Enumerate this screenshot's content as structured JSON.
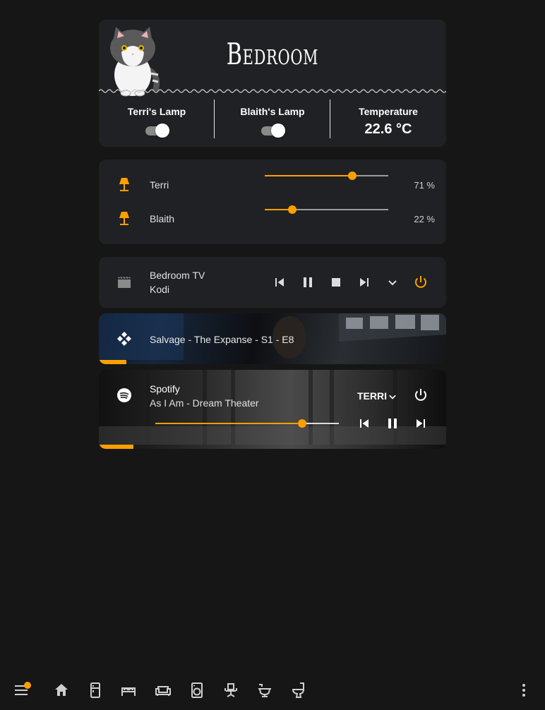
{
  "header": {
    "title": "Bedroom",
    "columns": [
      {
        "label": "Terri's Lamp",
        "type": "toggle",
        "on": true
      },
      {
        "label": "Blaith's Lamp",
        "type": "toggle",
        "on": true
      },
      {
        "label": "Temperature",
        "type": "value",
        "value": "22.6 °C"
      }
    ]
  },
  "lights": [
    {
      "name": "Terri",
      "brightness": 71,
      "pct_label": "71 %"
    },
    {
      "name": "Blaith",
      "brightness": 22,
      "pct_label": "22 %"
    }
  ],
  "tv": {
    "name": "Bedroom TV",
    "source": "Kodi",
    "controls": [
      "previous-icon",
      "pause-icon",
      "stop-icon",
      "next-icon",
      "chevron-down-icon",
      "power-icon"
    ]
  },
  "kodi": {
    "title": "Salvage - The Expanse - S1 - E8",
    "progress": 0.08
  },
  "spotify": {
    "app": "Spotify",
    "track": "As I Am - Dream Theater",
    "source": "TERRI",
    "volume": 0.8,
    "progress": 0.1
  },
  "colors": {
    "accent": "#ff9f00",
    "card": "#202124",
    "background": "#161616"
  },
  "navbar": {
    "icons": [
      "menu-icon",
      "home-icon",
      "fridge-icon",
      "bed-icon",
      "sofa-icon",
      "washing-machine-icon",
      "office-chair-icon",
      "bathtub-icon",
      "toilet-icon",
      "more-vertical-icon"
    ]
  }
}
